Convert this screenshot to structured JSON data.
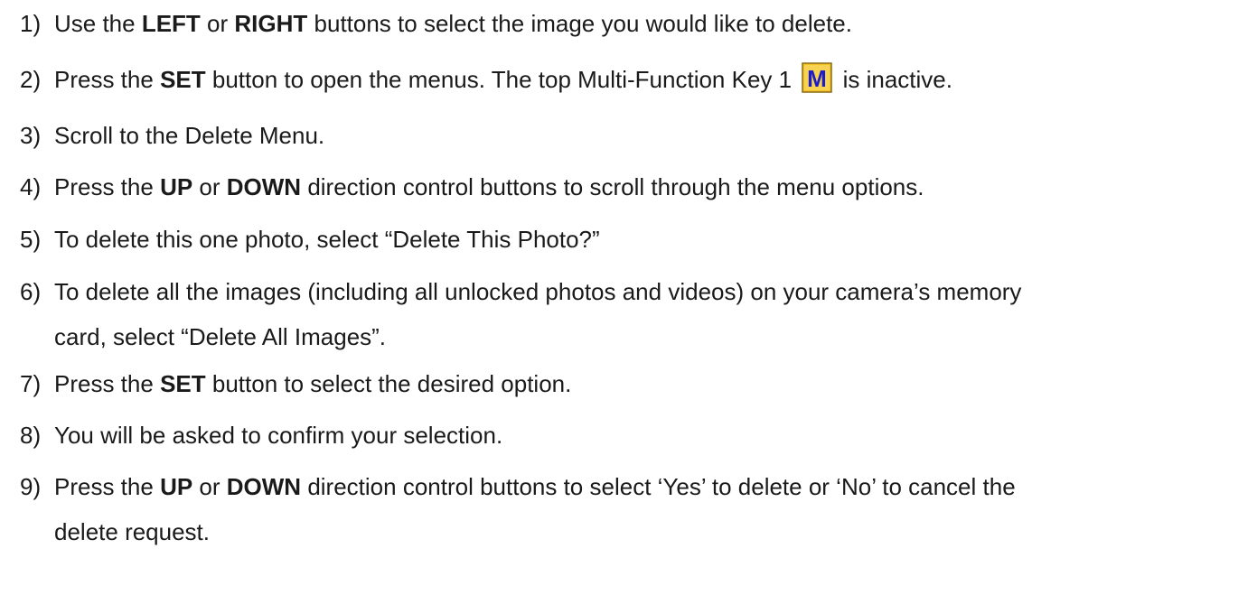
{
  "steps": [
    {
      "num": "1)",
      "parts": [
        "Use the ",
        "LEFT",
        " or ",
        "RIGHT",
        " buttons to select the image you would like to delete."
      ]
    },
    {
      "num": "2)",
      "parts": [
        "Press the ",
        "SET",
        " button to open the menus. The top Multi-Function Key 1",
        "is inactive."
      ],
      "icon": "m-function-key-icon",
      "icon_letter": "M",
      "icon_colors": {
        "fill": "#f3c12a",
        "letter": "#1c1cc8",
        "border": "#8a6a10"
      }
    },
    {
      "num": "3)",
      "text": "Scroll to the Delete Menu."
    },
    {
      "num": "4)",
      "parts": [
        "Press the ",
        "UP",
        " or ",
        "DOWN",
        " direction control buttons to scroll through the menu options."
      ]
    },
    {
      "num": "5)",
      "text": "To delete this one photo, select “Delete This Photo?”"
    },
    {
      "num": "6)",
      "line1": "To delete all the images (including all unlocked photos and videos) on your camera’s memory",
      "line2": "card, select “Delete All Images”."
    },
    {
      "num": "7)",
      "parts": [
        "Press the ",
        "SET",
        " button to select the desired option."
      ]
    },
    {
      "num": "8)",
      "text": "You will be asked to confirm your selection."
    },
    {
      "num": "9)",
      "parts": [
        "Press the ",
        "UP",
        " or ",
        "DOWN",
        " direction control buttons to select ‘Yes’ to delete or ‘No’ to cancel the"
      ],
      "line2": "delete request."
    }
  ]
}
